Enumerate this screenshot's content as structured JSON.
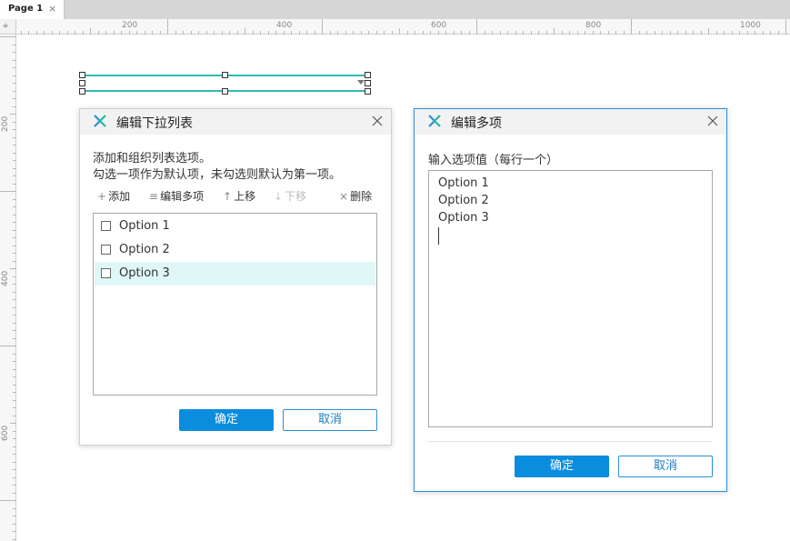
{
  "tabs": [
    {
      "label": "Page 1",
      "close": "×"
    }
  ],
  "ruler": {
    "corner_icon": "⌖",
    "horizontal": [
      "200",
      "400",
      "600",
      "800",
      "1000"
    ],
    "vertical": [
      "200",
      "400",
      "600"
    ]
  },
  "dropdown_widget": {
    "arrow_icon": "caret-down-icon"
  },
  "dialog_list": {
    "title": "编辑下拉列表",
    "description_line1": "添加和组织列表选项。",
    "description_line2": "勾选一项作为默认项，未勾选则默认为第一项。",
    "toolbar": {
      "add": {
        "icon": "+",
        "label": "添加"
      },
      "edit_multi": {
        "icon": "≡",
        "label": "编辑多项"
      },
      "move_up": {
        "icon": "↑",
        "label": "上移"
      },
      "move_down": {
        "icon": "↓",
        "label": "下移",
        "disabled": true
      },
      "delete": {
        "icon": "×",
        "label": "删除"
      }
    },
    "options": [
      {
        "label": "Option 1",
        "checked": false,
        "selected": false
      },
      {
        "label": "Option 2",
        "checked": false,
        "selected": false
      },
      {
        "label": "Option 3",
        "checked": false,
        "selected": true
      }
    ],
    "ok_label": "确定",
    "cancel_label": "取消"
  },
  "dialog_multi": {
    "title": "编辑多项",
    "prompt": "输入选项值（每行一个）",
    "lines": [
      "Option 1",
      "Option 2",
      "Option 3"
    ],
    "ok_label": "确定",
    "cancel_label": "取消"
  },
  "colors": {
    "accent": "#0a8ddd",
    "selection": "#33b8b0",
    "selected_row": "#dff7f7",
    "dialog_border_active": "#2a8fd8"
  }
}
